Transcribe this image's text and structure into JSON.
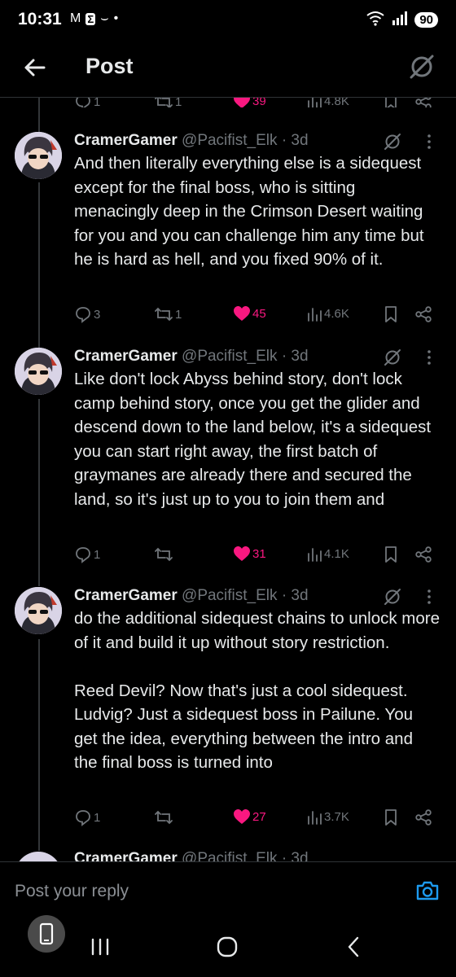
{
  "status_bar": {
    "time": "10:31",
    "battery": "90",
    "network": "6"
  },
  "header": {
    "title": "Post"
  },
  "prev_actions": {
    "replies": "1",
    "reposts": "1",
    "likes": "39",
    "views": "4.8K"
  },
  "posts": [
    {
      "name": "CramerGamer",
      "handle": "@Pacifist_Elk",
      "time": "· 3d",
      "text": "And then literally everything else is a sidequest except for the final boss, who is sitting menacingly deep in the Crimson Desert waiting for you and you can challenge him any time but he is hard as hell, and you fixed 90% of it.",
      "replies": "3",
      "reposts": "1",
      "likes": "45",
      "views": "4.6K"
    },
    {
      "name": "CramerGamer",
      "handle": "@Pacifist_Elk",
      "time": "· 3d",
      "text": "Like don't lock Abyss behind story, don't lock camp behind story, once you get the glider and descend down to the land below, it's a sidequest you can start right away, the first batch of graymanes are already there and secured the land, so it's just up to you to join them and",
      "replies": "1",
      "reposts": "",
      "likes": "31",
      "views": "4.1K"
    },
    {
      "name": "CramerGamer",
      "handle": "@Pacifist_Elk",
      "time": "· 3d",
      "text": "do the additional sidequest chains to unlock more of it and build it up without story restriction.\n\nReed Devil? Now that's just a cool sidequest. Ludvig? Just a sidequest boss in Pailune. You get the idea, everything between the intro and the final boss is turned into",
      "replies": "1",
      "reposts": "",
      "likes": "27",
      "views": "3.7K"
    }
  ],
  "partial_post": {
    "name": "CramerGamer",
    "handle": "@Pacifist_Elk",
    "time": "· 3d"
  },
  "reply_bar": {
    "placeholder": "Post your reply"
  },
  "colors": {
    "like": "#f91880",
    "muted": "#71767b",
    "accent": "#1d9bf0"
  }
}
